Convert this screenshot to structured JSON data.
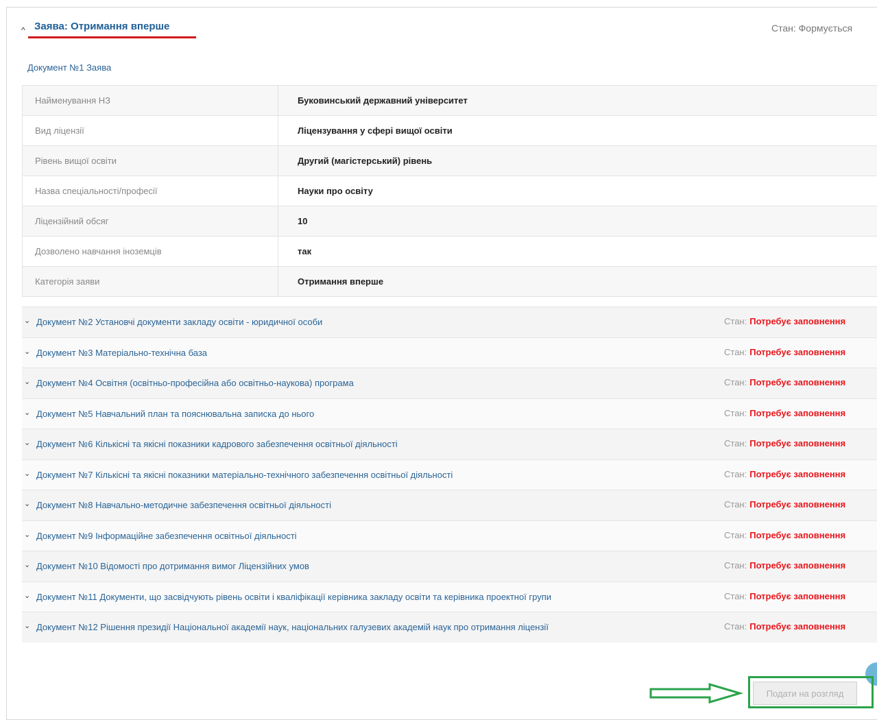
{
  "application": {
    "title": "Заява: Отримання вперше",
    "state_text": "Стан: Формується"
  },
  "document1": {
    "title": "Документ №1 Заява",
    "fields": [
      {
        "label": "Найменування НЗ",
        "value": "Буковинський державний університет"
      },
      {
        "label": "Вид ліцензії",
        "value": "Ліцензування у сфері вищої освіти"
      },
      {
        "label": "Рівень вищої освіти",
        "value": "Другий (магістерський) рівень"
      },
      {
        "label": "Назва спеціальності/професії",
        "value": "Науки про освіту"
      },
      {
        "label": "Ліцензійний обсяг",
        "value": "10"
      },
      {
        "label": "Дозволено навчання іноземців",
        "value": "так"
      },
      {
        "label": "Категорія заяви",
        "value": "Отримання вперше"
      }
    ]
  },
  "state_label": "Стан:",
  "documents": [
    {
      "title": "Документ №2 Установчі документи закладу освіти - юридичної особи",
      "state": "Потребує заповнення"
    },
    {
      "title": "Документ №3 Матеріально-технічна база",
      "state": "Потребує заповнення"
    },
    {
      "title": "Документ №4 Освітня (освітньо-професійна або освітньо-наукова) програма",
      "state": "Потребує заповнення"
    },
    {
      "title": "Документ №5 Навчальний план та пояснювальна записка до нього",
      "state": "Потребує заповнення"
    },
    {
      "title": "Документ №6 Кількісні та якісні показники кадрового забезпечення освітньої діяльності",
      "state": "Потребує заповнення"
    },
    {
      "title": "Документ №7 Кількісні та якісні показники матеріально-технічного забезпечення освітньої діяльності",
      "state": "Потребує заповнення"
    },
    {
      "title": "Документ №8 Навчально-методичне забезпечення освітньої діяльності",
      "state": "Потребує заповнення"
    },
    {
      "title": "Документ №9 Інформаційне забезпечення освітньої діяльності",
      "state": "Потребує заповнення"
    },
    {
      "title": "Документ №10 Відомості про дотримання вимог Ліцензійних умов",
      "state": "Потребує заповнення"
    },
    {
      "title": "Документ №11 Документи, що засвідчують рівень освіти і кваліфікації керівника закладу освіти та керівника проектної групи",
      "state": "Потребує заповнення"
    },
    {
      "title": "Документ №12 Рішення президії Національної академії наук, національних галузевих академій наук про отримання ліцензії",
      "state": "Потребує заповнення"
    }
  ],
  "submit_label": "Подати на розгляд",
  "icons": {
    "collapse": "chevron-up-icon",
    "expand": "chevron-down-icon",
    "annotation_arrow": "right-arrow-icon"
  },
  "colors": {
    "link": "#2a6496",
    "alert": "#e8161c",
    "underline": "#d11a1a",
    "highlight": "#2aa34a"
  }
}
